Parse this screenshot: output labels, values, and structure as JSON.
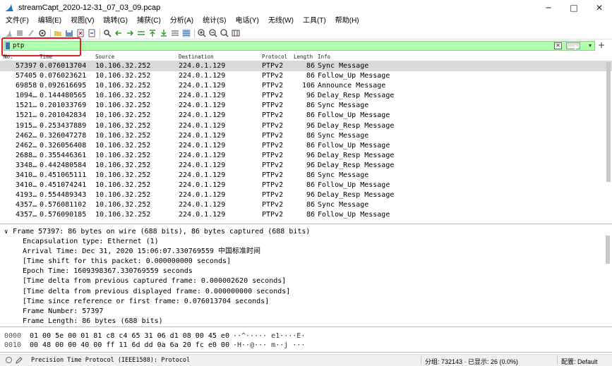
{
  "window": {
    "title": "streamCapt_2020-12-31_07_03_09.pcap",
    "controls": [
      "─",
      "□",
      "✕"
    ]
  },
  "menu": [
    "文件(F)",
    "编辑(E)",
    "视图(V)",
    "跳转(G)",
    "捕获(C)",
    "分析(A)",
    "统计(S)",
    "电话(Y)",
    "无线(W)",
    "工具(T)",
    "帮助(H)"
  ],
  "filter": {
    "value": "ptp",
    "clear_label": "✕",
    "dropdown_label": "▾",
    "add_label": "+"
  },
  "columns": {
    "no": "No.",
    "time": "Time",
    "source": "Source",
    "destination": "Destination",
    "protocol": "Protocol",
    "length": "Length",
    "info": "Info"
  },
  "packets": [
    {
      "no": "57397",
      "time": "0.076013704",
      "src": "10.106.32.252",
      "dst": "224.0.1.129",
      "proto": "PTPv2",
      "len": "86",
      "info": "Sync Message"
    },
    {
      "no": "57405",
      "time": "0.076023621",
      "src": "10.106.32.252",
      "dst": "224.0.1.129",
      "proto": "PTPv2",
      "len": "86",
      "info": "Follow_Up Message"
    },
    {
      "no": "69858",
      "time": "0.092616695",
      "src": "10.106.32.252",
      "dst": "224.0.1.129",
      "proto": "PTPv2",
      "len": "106",
      "info": "Announce Message"
    },
    {
      "no": "1094…",
      "time": "0.144480565",
      "src": "10.106.32.252",
      "dst": "224.0.1.129",
      "proto": "PTPv2",
      "len": "96",
      "info": "Delay_Resp Message"
    },
    {
      "no": "1521…",
      "time": "0.201033769",
      "src": "10.106.32.252",
      "dst": "224.0.1.129",
      "proto": "PTPv2",
      "len": "86",
      "info": "Sync Message"
    },
    {
      "no": "1521…",
      "time": "0.201042834",
      "src": "10.106.32.252",
      "dst": "224.0.1.129",
      "proto": "PTPv2",
      "len": "86",
      "info": "Follow_Up Message"
    },
    {
      "no": "1915…",
      "time": "0.253437889",
      "src": "10.106.32.252",
      "dst": "224.0.1.129",
      "proto": "PTPv2",
      "len": "96",
      "info": "Delay_Resp Message"
    },
    {
      "no": "2462…",
      "time": "0.326047278",
      "src": "10.106.32.252",
      "dst": "224.0.1.129",
      "proto": "PTPv2",
      "len": "86",
      "info": "Sync Message"
    },
    {
      "no": "2462…",
      "time": "0.326056408",
      "src": "10.106.32.252",
      "dst": "224.0.1.129",
      "proto": "PTPv2",
      "len": "86",
      "info": "Follow_Up Message"
    },
    {
      "no": "2688…",
      "time": "0.355446361",
      "src": "10.106.32.252",
      "dst": "224.0.1.129",
      "proto": "PTPv2",
      "len": "96",
      "info": "Delay_Resp Message"
    },
    {
      "no": "3348…",
      "time": "0.442480584",
      "src": "10.106.32.252",
      "dst": "224.0.1.129",
      "proto": "PTPv2",
      "len": "96",
      "info": "Delay_Resp Message"
    },
    {
      "no": "3410…",
      "time": "0.451065111",
      "src": "10.106.32.252",
      "dst": "224.0.1.129",
      "proto": "PTPv2",
      "len": "86",
      "info": "Sync Message"
    },
    {
      "no": "3410…",
      "time": "0.451074241",
      "src": "10.106.32.252",
      "dst": "224.0.1.129",
      "proto": "PTPv2",
      "len": "86",
      "info": "Follow_Up Message"
    },
    {
      "no": "4193…",
      "time": "0.554489343",
      "src": "10.106.32.252",
      "dst": "224.0.1.129",
      "proto": "PTPv2",
      "len": "96",
      "info": "Delay_Resp Message"
    },
    {
      "no": "4357…",
      "time": "0.576081102",
      "src": "10.106.32.252",
      "dst": "224.0.1.129",
      "proto": "PTPv2",
      "len": "86",
      "info": "Sync Message"
    },
    {
      "no": "4357…",
      "time": "0.576090185",
      "src": "10.106.32.252",
      "dst": "224.0.1.129",
      "proto": "PTPv2",
      "len": "86",
      "info": "Follow_Up Message"
    }
  ],
  "details": {
    "frame": "Frame 57397: 86 bytes on wire (688 bits), 86 bytes captured (688 bits)",
    "lines": [
      "Encapsulation type: Ethernet (1)",
      "Arrival Time: Dec 31, 2020 15:06:07.330769559 中国标准时间",
      "[Time shift for this packet: 0.000000000 seconds]",
      "Epoch Time: 1609398367.330769559 seconds",
      "[Time delta from previous captured frame: 0.000002620 seconds]",
      "[Time delta from previous displayed frame: 0.000000000 seconds]",
      "[Time since reference or first frame: 0.076013704 seconds]",
      "Frame Number: 57397",
      "Frame Length: 86 bytes (688 bits)"
    ]
  },
  "bytes": [
    {
      "offset": "0000",
      "hex": "01 00 5e 00 01 81 c8 c4  65 31 06 d1 08 00 45 e0",
      "ascii": "··^····· e1····E·"
    },
    {
      "offset": "0010",
      "hex": "00 48 00 00 40 00 ff 11  6d dd 0a 6a 20 fc e0 00",
      "ascii": "·H··@··· m··j ···"
    }
  ],
  "status": {
    "text": "Precision Time Protocol (IEEE1588): Protocol",
    "stats": "分组: 732143 · 已显示: 26 (0.0%)",
    "profile": "配置: Default"
  },
  "colors": {
    "filter_bg": "#afffaf",
    "selected_row": "#d9d9d9",
    "highlight": "#e02020"
  }
}
